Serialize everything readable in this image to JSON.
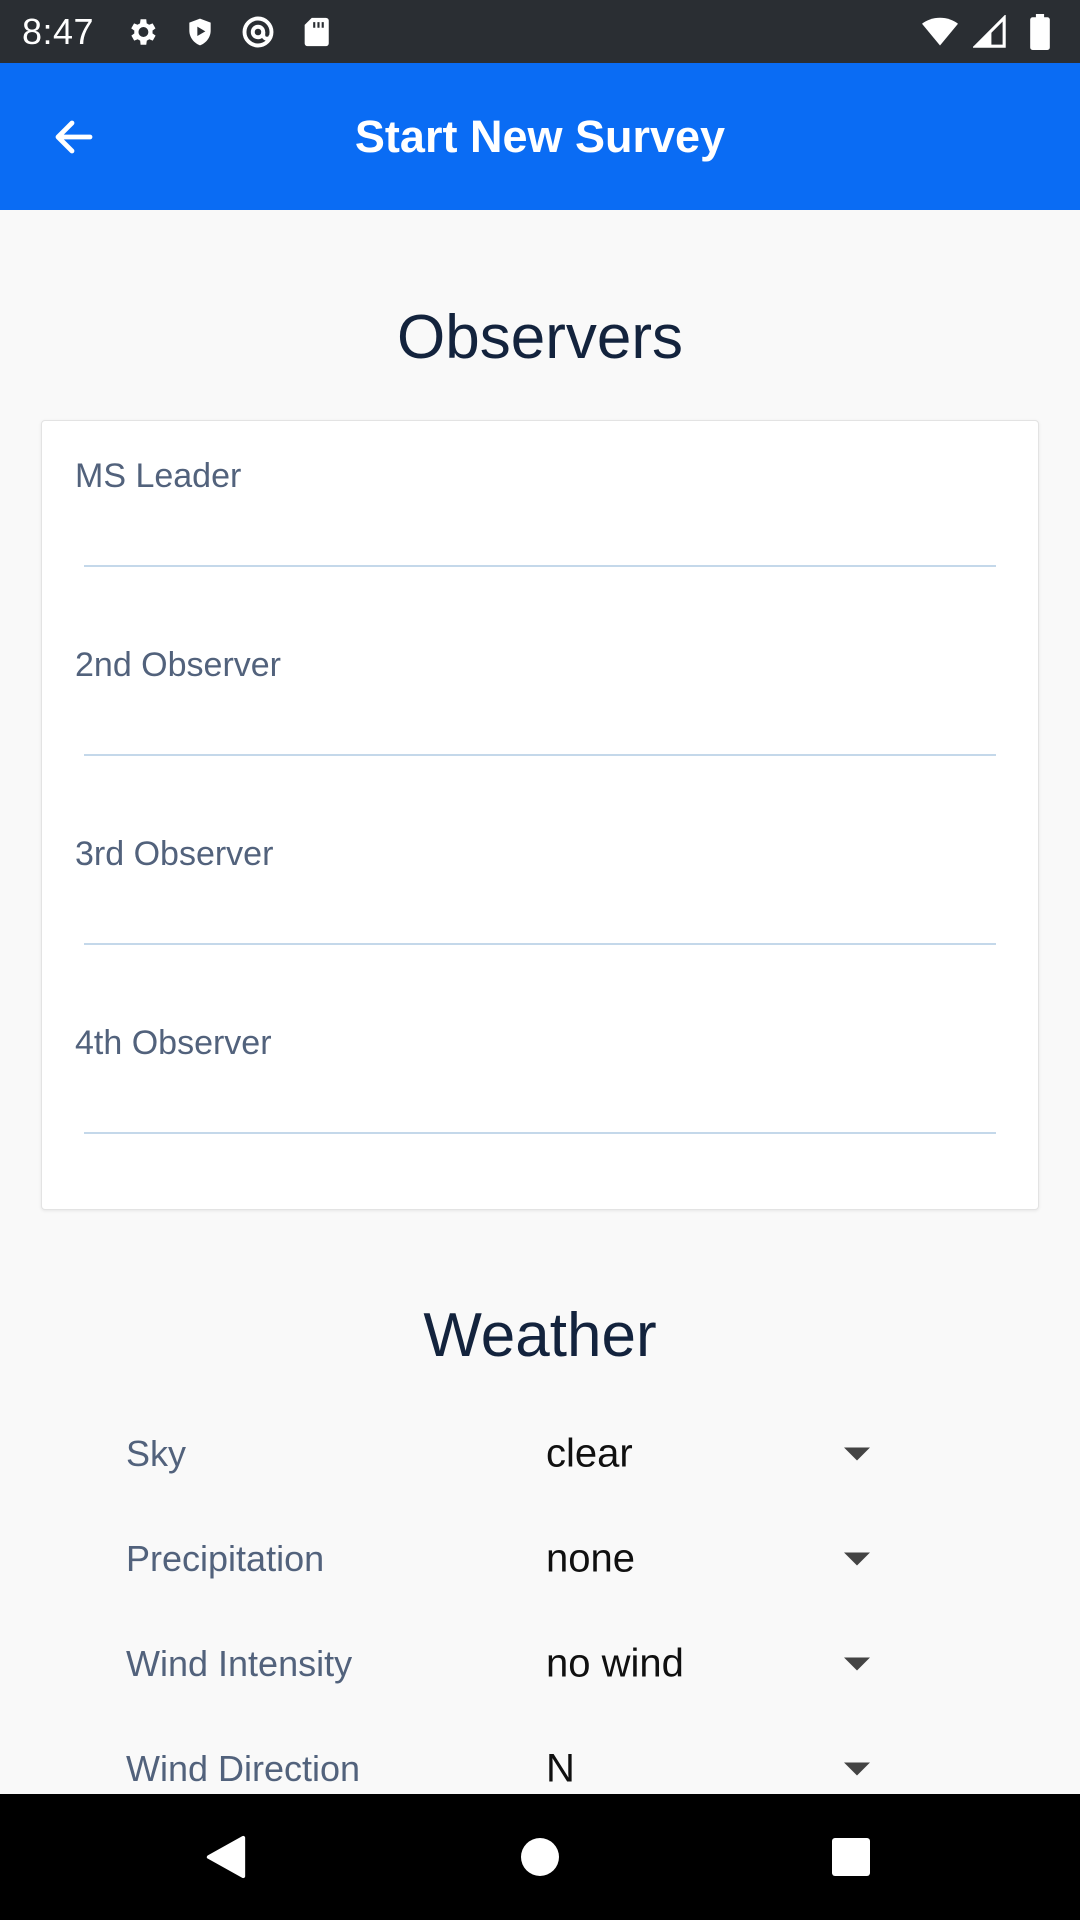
{
  "status_bar": {
    "time": "8:47",
    "left_icons": [
      "settings-icon",
      "shield-play-icon",
      "at-sign-icon",
      "sd-card-icon"
    ],
    "right_icons": [
      "wifi-icon",
      "cell-signal-icon",
      "battery-icon"
    ]
  },
  "app_bar": {
    "title": "Start New Survey",
    "back_icon": "arrow-left-icon"
  },
  "observers": {
    "heading": "Observers",
    "fields": [
      {
        "label": "MS Leader",
        "value": ""
      },
      {
        "label": "2nd Observer",
        "value": ""
      },
      {
        "label": "3rd Observer",
        "value": ""
      },
      {
        "label": "4th Observer",
        "value": ""
      }
    ]
  },
  "weather": {
    "heading": "Weather",
    "rows": [
      {
        "label": "Sky",
        "value": "clear"
      },
      {
        "label": "Precipitation",
        "value": "none"
      },
      {
        "label": "Wind Intensity",
        "value": "no wind"
      },
      {
        "label": "Wind Direction",
        "value": "N"
      }
    ]
  },
  "nav_bar": {
    "icons": [
      "back-triangle-icon",
      "home-circle-icon",
      "recents-square-icon"
    ]
  },
  "colors": {
    "status_bar": "#2a2e33",
    "app_bar": "#0a6cf4",
    "heading_text": "#13233d",
    "label_text": "#52627c",
    "input_underline": "#c4d8ea",
    "background": "#f9f9f9"
  }
}
